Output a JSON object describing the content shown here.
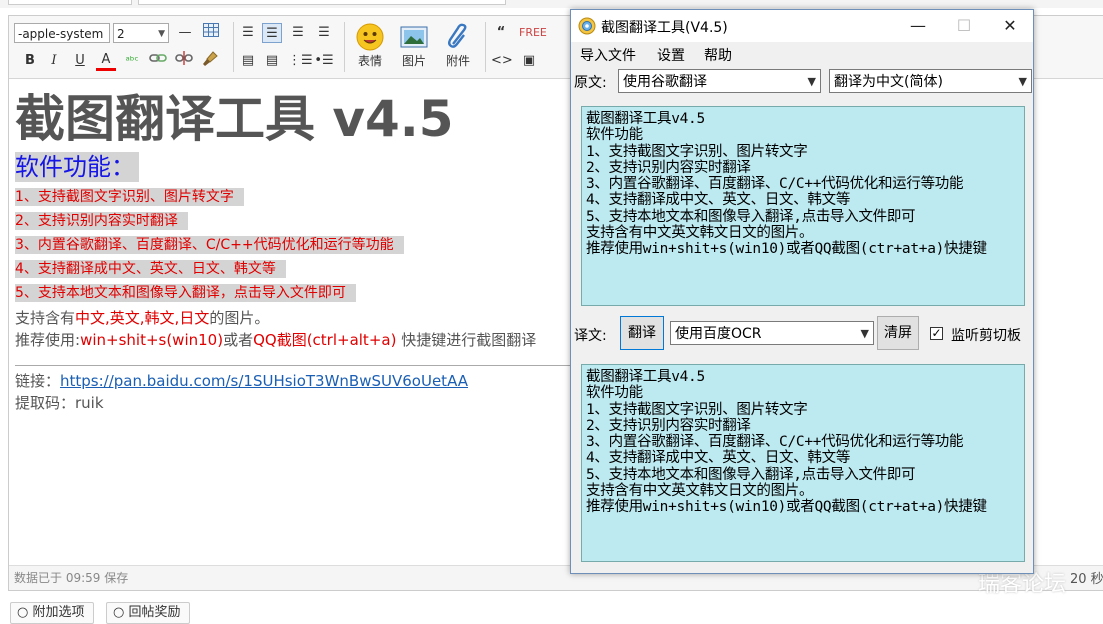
{
  "editor": {
    "font_family_value": "-apple-system",
    "font_size_value": "2",
    "buttons": {
      "emoji": "表情",
      "image": "图片",
      "attachment": "附件"
    },
    "content": {
      "title": "截图翻译工具 v4.5",
      "heading": "软件功能：",
      "features": [
        "1、支持截图文字识别、图片转文字",
        "2、支持识别内容实时翻译",
        "3、内置谷歌翻译、百度翻译、C/C++代码优化和运行等功能",
        "4、支持翻译成中文、英文、日文、韩文等",
        "5、支持本地文本和图像导入翻译，点击导入文件即可"
      ],
      "support_prefix": "支持含有",
      "support_langs": "中文,英文,韩文,日文",
      "support_suffix": "的图片。",
      "recommend_prefix": "推荐使用:",
      "recommend_keys": "win+shit+s(win10)",
      "recommend_mid": "或者",
      "recommend_qq": "QQ截图(ctrl+alt+a)",
      "recommend_suffix": " 快捷键进行截图翻译",
      "link_label": "链接：",
      "link_url": "https://pan.baidu.com/s/1SUHsioT3WnBwSUV6oUetAA",
      "code_label": "提取码：ruik"
    },
    "status": "数据已于 09:59 保存",
    "bottom_buttons": [
      "附加选项",
      "回帖奖励"
    ],
    "watermark": "瑞客论坛",
    "seconds": "20 秒"
  },
  "window": {
    "title": "截图翻译工具(V4.5)",
    "controls": {
      "minimize": "—",
      "maximize": "☐",
      "close": "✕"
    },
    "menu": [
      "导入文件",
      "设置",
      "帮助"
    ],
    "source_label": "原文:",
    "source_engine": "使用谷歌翻译",
    "target_lang": "翻译为中文(简体)",
    "source_text": "截图翻译工具v4.5\n软件功能\n1、支持截图文字识别、图片转文字\n2、支持识别内容实时翻译\n3、内置谷歌翻译、百度翻译、C/C++代码优化和运行等功能\n4、支持翻译成中文、英文、日文、韩文等\n5、支持本地文本和图像导入翻译,点击导入文件即可\n支持含有中文英文韩文日文的图片。\n推荐使用win+shit+s(win10)或者QQ截图(ctr+at+a)快捷键",
    "result_label": "译文:",
    "translate_button": "翻译",
    "ocr_engine": "使用百度OCR",
    "clear_button": "清屏",
    "clipboard_label": "监听剪切板",
    "clipboard_checked": true,
    "result_text": "截图翻译工具v4.5\n软件功能\n1、支持截图文字识别、图片转文字\n2、支持识别内容实时翻译\n3、内置谷歌翻译、百度翻译、C/C++代码优化和运行等功能\n4、支持翻译成中文、英文、日文、韩文等\n5、支持本地文本和图像导入翻译,点击导入文件即可\n支持含有中文英文韩文日文的图片。\n推荐使用win+shit+s(win10)或者QQ截图(ctr+at+a)快捷键"
  },
  "colors": {
    "textarea_bg": "#bde9f0",
    "feature_red": "#e00000",
    "heading_blue": "#1515e6"
  }
}
